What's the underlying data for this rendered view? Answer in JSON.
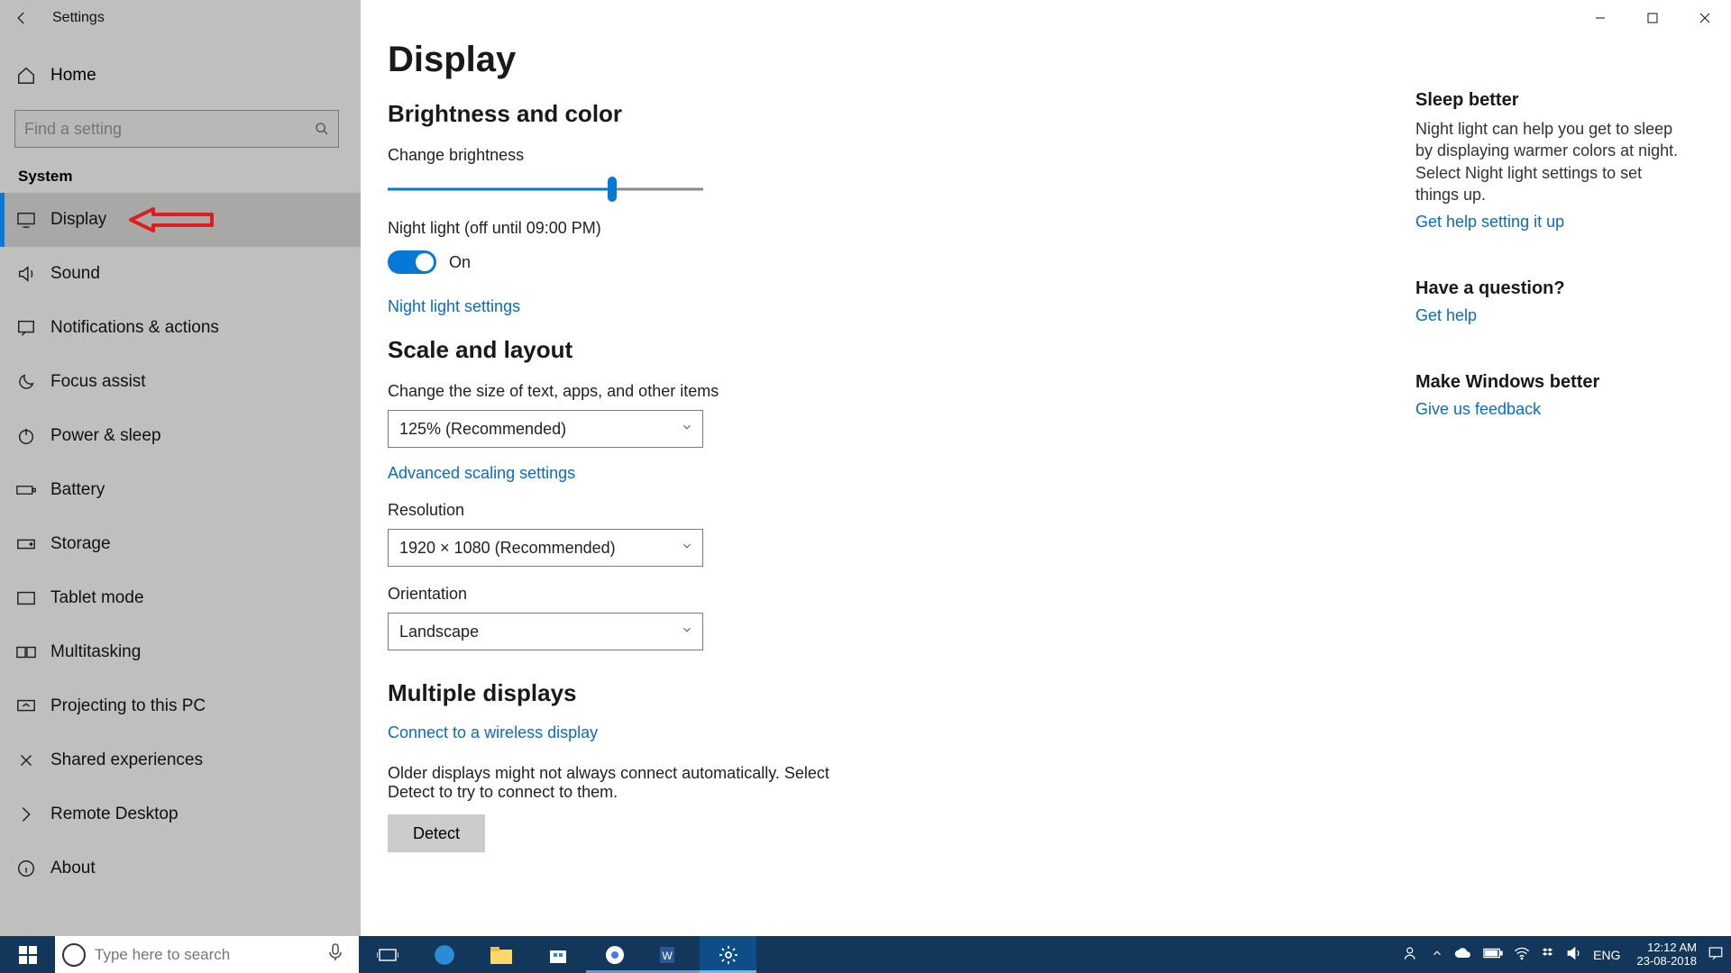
{
  "titlebar": {
    "title": "Settings"
  },
  "sidebar": {
    "home": "Home",
    "search_placeholder": "Find a setting",
    "group": "System",
    "items": [
      {
        "label": "Display"
      },
      {
        "label": "Sound"
      },
      {
        "label": "Notifications & actions"
      },
      {
        "label": "Focus assist"
      },
      {
        "label": "Power & sleep"
      },
      {
        "label": "Battery"
      },
      {
        "label": "Storage"
      },
      {
        "label": "Tablet mode"
      },
      {
        "label": "Multitasking"
      },
      {
        "label": "Projecting to this PC"
      },
      {
        "label": "Shared experiences"
      },
      {
        "label": "Remote Desktop"
      },
      {
        "label": "About"
      }
    ]
  },
  "main": {
    "title": "Display",
    "sec_brightness": "Brightness and color",
    "brightness_label": "Change brightness",
    "brightness_pct": 71,
    "nightlight_label": "Night light (off until 09:00 PM)",
    "nightlight_state": "On",
    "nightlight_link": "Night light settings",
    "sec_scale": "Scale and layout",
    "scale_label": "Change the size of text, apps, and other items",
    "scale_value": "125% (Recommended)",
    "scale_link": "Advanced scaling settings",
    "resolution_label": "Resolution",
    "resolution_value": "1920 × 1080 (Recommended)",
    "orientation_label": "Orientation",
    "orientation_value": "Landscape",
    "sec_multi": "Multiple displays",
    "wireless_link": "Connect to a wireless display",
    "detect_text": "Older displays might not always connect automatically. Select Detect to try to connect to them.",
    "detect_btn": "Detect"
  },
  "rightcol": {
    "b1_h": "Sleep better",
    "b1_p": "Night light can help you get to sleep by displaying warmer colors at night. Select Night light settings to set things up.",
    "b1_l": "Get help setting it up",
    "b2_h": "Have a question?",
    "b2_l": "Get help",
    "b3_h": "Make Windows better",
    "b3_l": "Give us feedback"
  },
  "taskbar": {
    "search_placeholder": "Type here to search",
    "lang": "ENG",
    "time": "12:12 AM",
    "date": "23-08-2018"
  }
}
